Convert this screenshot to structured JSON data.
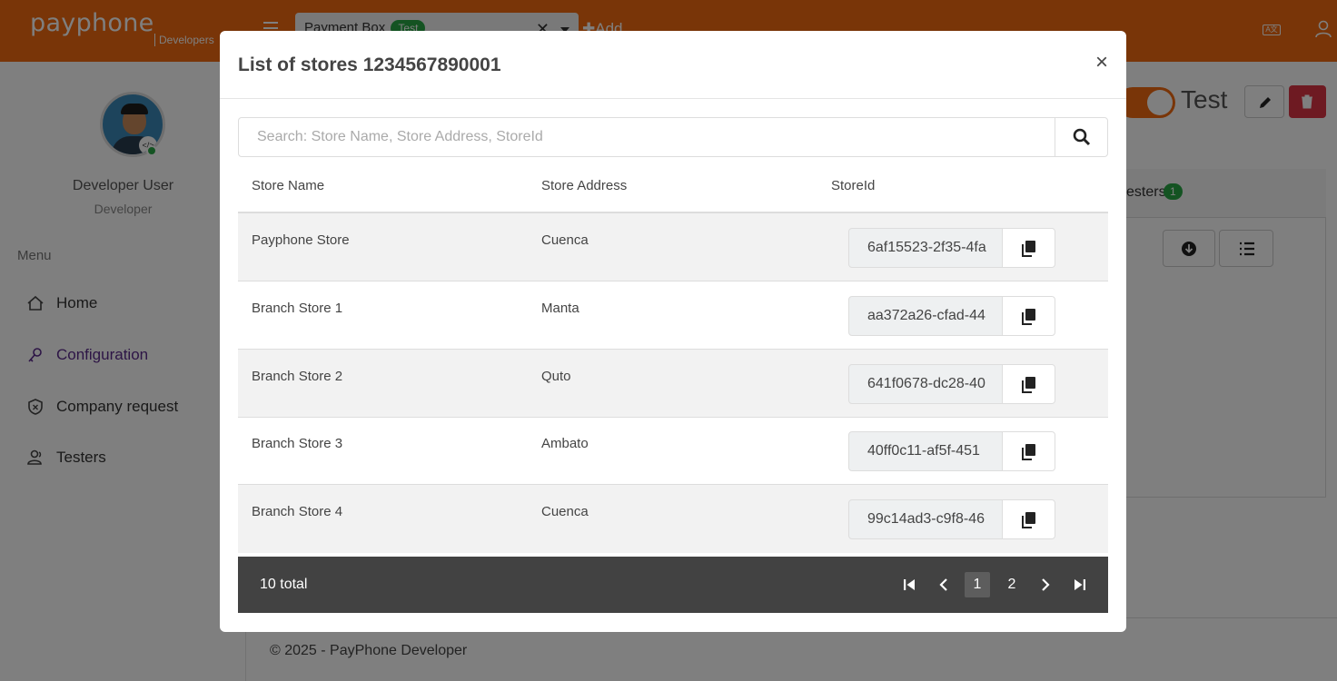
{
  "topbar": {
    "logo": "payphone",
    "logo_sub": "Developers",
    "tab_label": "Payment Box",
    "tab_badge": "Test",
    "tab_close": "✕",
    "add_label": "Add"
  },
  "sidebar": {
    "user_name": "Developer User",
    "user_role": "Developer",
    "menu_label": "Menu",
    "items": [
      {
        "label": "Home",
        "icon": "home-icon"
      },
      {
        "label": "Configuration",
        "icon": "key-icon"
      },
      {
        "label": "Company request",
        "icon": "shield-icon"
      },
      {
        "label": "Testers",
        "icon": "users-icon"
      }
    ]
  },
  "main": {
    "mode_label": "Test",
    "testers_label": "esters",
    "testers_count": "1",
    "footer": "© 2025 - PayPhone Developer"
  },
  "modal": {
    "title": "List of stores 1234567890001",
    "close": "×",
    "search_placeholder": "Search: Store Name, Store Address, StoreId",
    "columns": [
      "Store Name",
      "Store Address",
      "StoreId"
    ],
    "rows": [
      {
        "name": "Payphone Store",
        "address": "Cuenca",
        "store_id": "6af15523-2f35-4fa"
      },
      {
        "name": "Branch Store 1",
        "address": "Manta",
        "store_id": "aa372a26-cfad-44"
      },
      {
        "name": "Branch Store 2",
        "address": "Quto",
        "store_id": "641f0678-dc28-40"
      },
      {
        "name": "Branch Store 3",
        "address": "Ambato",
        "store_id": "40ff0c11-af5f-451"
      },
      {
        "name": "Branch Store 4",
        "address": "Cuenca",
        "store_id": "99c14ad3-c9f8-46"
      }
    ],
    "pager": {
      "total": "10 total",
      "pages": [
        "1",
        "2"
      ],
      "current": "1"
    }
  },
  "colors": {
    "brand": "#f26b10",
    "active_menu": "#5b2a8c",
    "badge": "#28a745",
    "danger": "#dc3545",
    "pager_bg": "#424242"
  }
}
